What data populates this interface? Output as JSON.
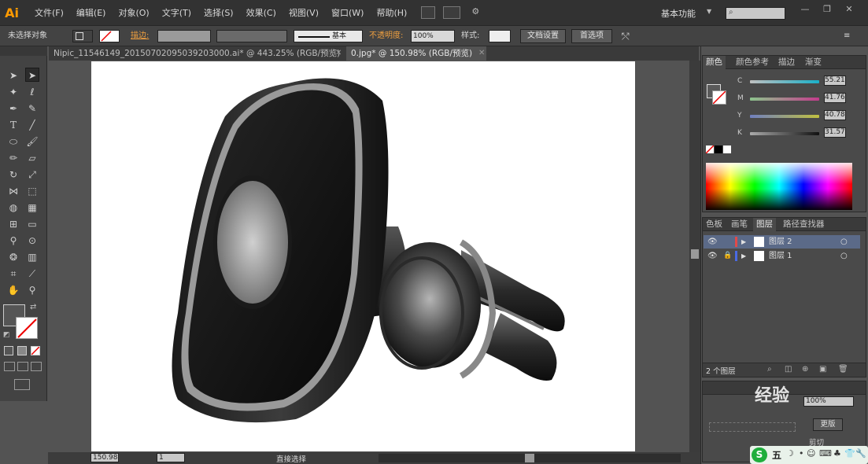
{
  "app": {
    "logo": "Ai"
  },
  "menu": [
    "文件(F)",
    "编辑(E)",
    "对象(O)",
    "文字(T)",
    "选择(S)",
    "效果(C)",
    "视图(V)",
    "窗口(W)",
    "帮助(H)"
  ],
  "workspace_label": "基本功能",
  "control": {
    "no_selection": "未选择对象",
    "stroke_label": "描边:",
    "stroke_style": "基本",
    "opacity_label": "不透明度:",
    "opacity_value": "100%",
    "style_label": "样式:",
    "doc_settings": "文档设置",
    "preferences": "首选项"
  },
  "tabs": [
    {
      "label": "Nipic_11546149_20150702095039203000.ai* @ 443.25% (RGB/预览)",
      "active": false
    },
    {
      "label": "0.jpg* @ 150.98% (RGB/预览)",
      "active": true
    }
  ],
  "color_panel": {
    "tabs": [
      "颜色",
      "颜色参考",
      "描边",
      "渐变"
    ],
    "channels": [
      {
        "name": "C",
        "value": "55.21"
      },
      {
        "name": "M",
        "value": "41.76"
      },
      {
        "name": "Y",
        "value": "40.78"
      },
      {
        "name": "K",
        "value": "31.57"
      }
    ]
  },
  "layers_panel": {
    "tabs": [
      "色板",
      "画笔",
      "图层",
      "路径查找器"
    ],
    "layers": [
      {
        "name": "图层 2",
        "color": "#e24a4a",
        "selected": true
      },
      {
        "name": "图层 1",
        "color": "#4a6ae2",
        "selected": false
      }
    ],
    "count_label": "2 个图层"
  },
  "bottom_panel": {
    "opacity_value": "100%",
    "button_label": "更版",
    "clip_label": "剪切"
  },
  "status": {
    "zoom": "150.98",
    "artboard": "1",
    "tool_label": "直接选择"
  },
  "watermark": {
    "text": "经验"
  },
  "ime": {
    "label": "五"
  },
  "colors": {
    "accent": "#ff9a00",
    "stroke_label": "#f0a040",
    "panel_bg": "#4a4a4a"
  }
}
